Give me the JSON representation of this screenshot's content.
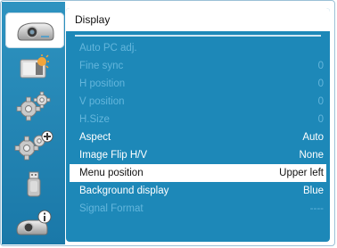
{
  "sidebar": {
    "items": [
      {
        "icon": "projector-icon",
        "active": true
      },
      {
        "icon": "image-adjust-icon",
        "active": false
      },
      {
        "icon": "settings-gear-icon",
        "active": false
      },
      {
        "icon": "expanded-settings-gear-icon",
        "active": false
      },
      {
        "icon": "usb-icon",
        "active": false
      },
      {
        "icon": "information-icon",
        "active": false
      }
    ]
  },
  "panel": {
    "title": "Display",
    "rows": [
      {
        "label": "Auto PC adj.",
        "value": "",
        "state": "disabled"
      },
      {
        "label": "Fine sync",
        "value": "0",
        "state": "disabled"
      },
      {
        "label": "H position",
        "value": "0",
        "state": "disabled"
      },
      {
        "label": "V position",
        "value": "0",
        "state": "disabled"
      },
      {
        "label": "H.Size",
        "value": "0",
        "state": "disabled"
      },
      {
        "label": "Aspect",
        "value": "Auto",
        "state": "enabled"
      },
      {
        "label": "Image Flip H/V",
        "value": "None",
        "state": "enabled"
      },
      {
        "label": "Menu position",
        "value": "Upper left",
        "state": "selected"
      },
      {
        "label": "Background display",
        "value": "Blue",
        "state": "enabled"
      },
      {
        "label": "Signal Format",
        "value": "----",
        "state": "disabled"
      }
    ]
  },
  "colors": {
    "panel_bg": "#1d88b8",
    "sidebar_bg": "#1a78a8",
    "disabled_text": "#64b6dc",
    "selected_bg": "#ffffff"
  }
}
